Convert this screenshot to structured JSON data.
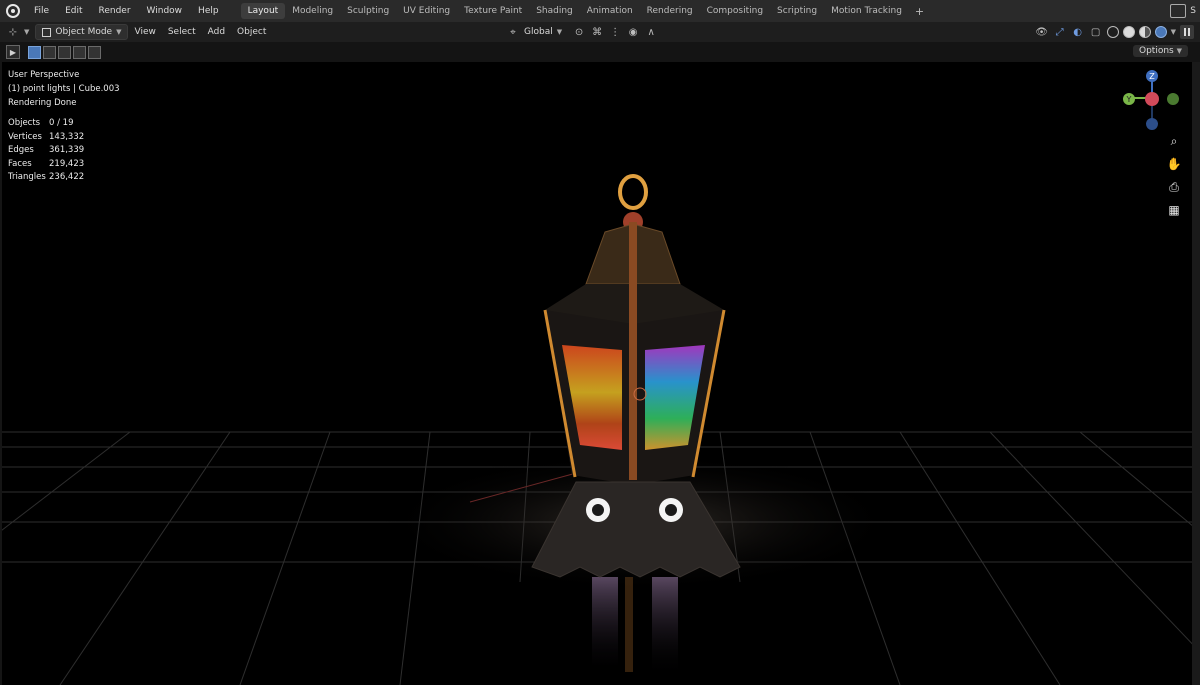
{
  "menu": [
    "File",
    "Edit",
    "Render",
    "Window",
    "Help"
  ],
  "workspaces": [
    "Layout",
    "Modeling",
    "Sculpting",
    "UV Editing",
    "Texture Paint",
    "Shading",
    "Animation",
    "Rendering",
    "Compositing",
    "Scripting",
    "Motion Tracking"
  ],
  "active_workspace": "Layout",
  "top_right": {
    "scene_label": "S"
  },
  "header": {
    "mode": "Object Mode",
    "menus": [
      "View",
      "Select",
      "Add",
      "Object"
    ],
    "transform_orientation": "Global",
    "options_label": "Options"
  },
  "viewport": {
    "view_name": "User Perspective",
    "collection_info": "(1) point lights | Cube.003",
    "render_status": "Rendering Done",
    "stats": [
      {
        "label": "Objects",
        "value": "0 / 19"
      },
      {
        "label": "Vertices",
        "value": "143,332"
      },
      {
        "label": "Edges",
        "value": "361,339"
      },
      {
        "label": "Faces",
        "value": "219,423"
      },
      {
        "label": "Triangles",
        "value": "236,422"
      }
    ],
    "gizmo": {
      "z_label": "Z",
      "y_label": "Y"
    }
  },
  "colors": {
    "accent_blue": "#4a78b8",
    "axis_x": "#d24a5a",
    "axis_y": "#7ab648",
    "axis_z": "#3f6fc0",
    "grid_line": "#3a3a3a",
    "lantern_gold": "#c8862a"
  },
  "icons": [
    "blender-logo",
    "editor-type-icon",
    "object-mode-cube-icon",
    "transform-orientation-icon",
    "snap-icon",
    "proportional-edit-icon",
    "visibility-icon",
    "gizmo-icon",
    "overlay-icon",
    "xray-icon",
    "wireframe-shading-icon",
    "solid-shading-icon",
    "material-shading-icon",
    "rendered-shading-icon",
    "zoom-icon",
    "hand-pan-icon",
    "camera-icon",
    "grid-view-icon",
    "pause-icon"
  ]
}
